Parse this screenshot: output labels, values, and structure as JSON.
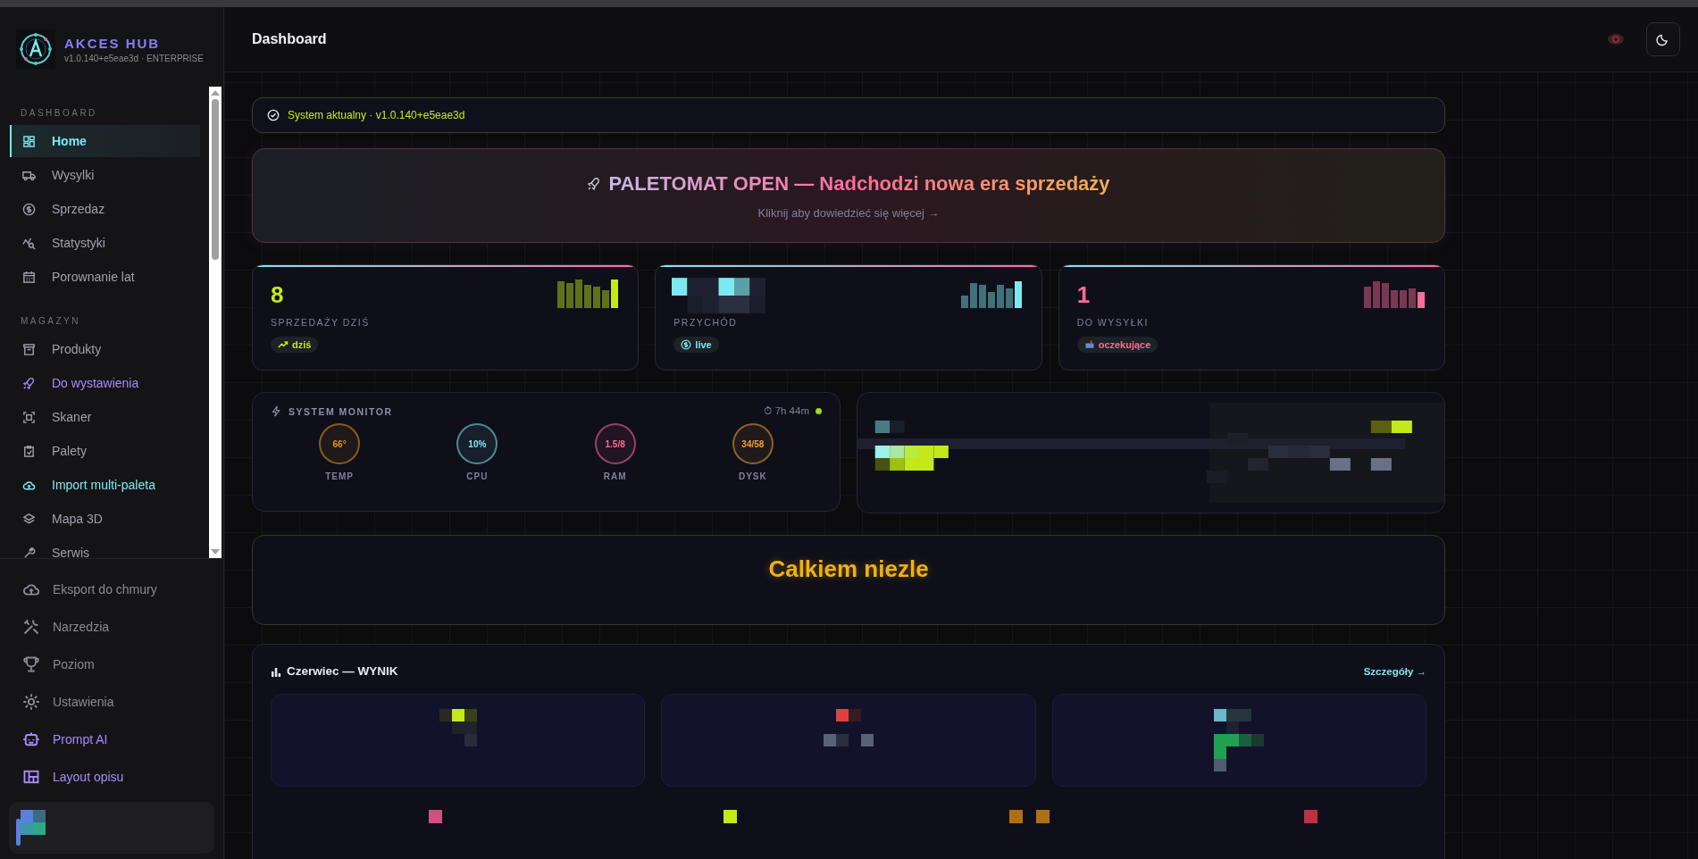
{
  "sidebar": {
    "brand": {
      "title": "AKCES HUB",
      "subtitle": "v1.0.140+e5eae3d · ENTERPRISE"
    },
    "sections": [
      {
        "heading": "DASHBOARD",
        "items": [
          {
            "label": "Home",
            "selected": true,
            "color": "#7ee8f0"
          },
          {
            "label": "Wysylki",
            "selected": false,
            "color": "#a1a1aa"
          },
          {
            "label": "Sprzedaz",
            "selected": false,
            "color": "#a1a1aa"
          },
          {
            "label": "Statystyki",
            "selected": false,
            "color": "#a1a1aa"
          },
          {
            "label": "Porownanie lat",
            "selected": false,
            "color": "#a1a1aa"
          }
        ]
      },
      {
        "heading": "MAGAZYN",
        "items": [
          {
            "label": "Produkty",
            "selected": false,
            "color": "#a1a1aa"
          },
          {
            "label": "Do wystawienia",
            "selected": false,
            "color": "#a78bfa"
          },
          {
            "label": "Skaner",
            "selected": false,
            "color": "#a1a1aa"
          },
          {
            "label": "Palety",
            "selected": false,
            "color": "#a1a1aa"
          },
          {
            "label": "Import multi-paleta",
            "selected": false,
            "color": "#7ee8f0"
          },
          {
            "label": "Mapa 3D",
            "selected": false,
            "color": "#a1a1aa"
          },
          {
            "label": "Serwis",
            "selected": false,
            "color": "#a1a1aa"
          }
        ]
      }
    ],
    "footer_items": [
      {
        "label": "Eksport do chmury",
        "selected": false,
        "color": "#8a8a92"
      },
      {
        "label": "Narzedzia",
        "selected": false,
        "color": "#8a8a92"
      },
      {
        "label": "Poziom",
        "selected": false,
        "color": "#8a8a92"
      },
      {
        "label": "Ustawienia",
        "selected": false,
        "color": "#8a8a92"
      },
      {
        "label": "Prompt AI",
        "selected": false,
        "color": "#a78bfa"
      },
      {
        "label": "Layout opisu",
        "selected": false,
        "color": "#a78bfa"
      }
    ]
  },
  "header": {
    "title": "Dashboard"
  },
  "status": {
    "text": "System aktualny · v1.0.140+e5eae3d"
  },
  "banner": {
    "title": "PALETOMAT OPEN — Nadchodzi nowa era sprzedaży",
    "subtitle": "Kliknij aby dowiedzieć się więcej →"
  },
  "stats": [
    {
      "value": "8",
      "label": "SPRZEDAŻY DZIŚ",
      "badge": "dziś",
      "color": "#c5e81a"
    },
    {
      "label": "PRZYCHÓD",
      "badge": "live",
      "color": "#7ee8f0"
    },
    {
      "value": "1",
      "label": "DO WYSYŁKI",
      "badge": "oczekujące",
      "color": "#ff6b9a"
    }
  ],
  "monitor": {
    "title": "SYSTEM MONITOR",
    "uptime": "⏱ 7h 44m",
    "gauges": [
      {
        "value": "66°",
        "label": "TEMP",
        "color": "#e8941a"
      },
      {
        "value": "10%",
        "label": "CPU",
        "color": "#7ee8f0"
      },
      {
        "value": "1.5/8",
        "label": "RAM",
        "color": "#ff6b9a"
      },
      {
        "value": "34/58",
        "label": "DYSK",
        "color": "#f0a030"
      }
    ]
  },
  "rating": {
    "text": "Calkiem niezle"
  },
  "month": {
    "title": "Czerwiec — WYNIK",
    "link": "Szczegóły →"
  }
}
